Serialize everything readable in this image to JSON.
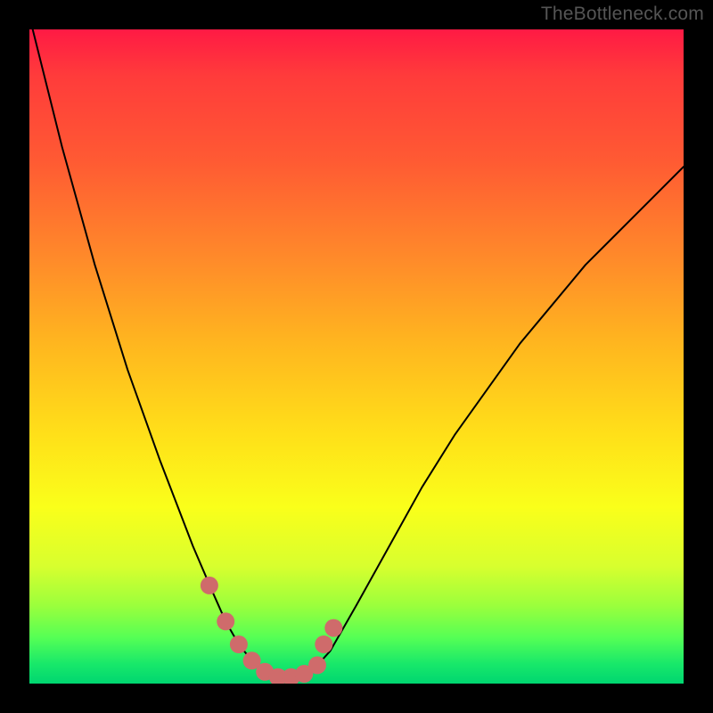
{
  "watermark": "TheBottleneck.com",
  "chart_data": {
    "type": "line",
    "title": "",
    "xlabel": "",
    "ylabel": "",
    "xlim": [
      0,
      1
    ],
    "ylim": [
      0,
      1
    ],
    "series": [
      {
        "name": "bottleneck-curve",
        "x": [
          0.0,
          0.05,
          0.1,
          0.15,
          0.2,
          0.25,
          0.28,
          0.3,
          0.32,
          0.34,
          0.36,
          0.38,
          0.4,
          0.42,
          0.44,
          0.46,
          0.5,
          0.55,
          0.6,
          0.65,
          0.7,
          0.75,
          0.8,
          0.85,
          0.9,
          0.95,
          1.0
        ],
        "y": [
          1.02,
          0.82,
          0.64,
          0.48,
          0.34,
          0.21,
          0.14,
          0.095,
          0.06,
          0.035,
          0.018,
          0.01,
          0.01,
          0.015,
          0.028,
          0.05,
          0.12,
          0.21,
          0.3,
          0.38,
          0.45,
          0.52,
          0.58,
          0.64,
          0.69,
          0.74,
          0.79
        ]
      }
    ],
    "highlight_points": {
      "name": "near-optimal-markers",
      "color": "#cf6b6b",
      "x": [
        0.275,
        0.3,
        0.32,
        0.34,
        0.36,
        0.38,
        0.4,
        0.42,
        0.44,
        0.45,
        0.465
      ],
      "y": [
        0.15,
        0.095,
        0.06,
        0.035,
        0.018,
        0.01,
        0.01,
        0.015,
        0.028,
        0.06,
        0.085
      ]
    },
    "background_gradient": {
      "top": "#ff1a44",
      "upper_mid": "#ffb61f",
      "mid": "#faff1a",
      "lower_mid": "#9cff3c",
      "bottom": "#00d670"
    }
  }
}
